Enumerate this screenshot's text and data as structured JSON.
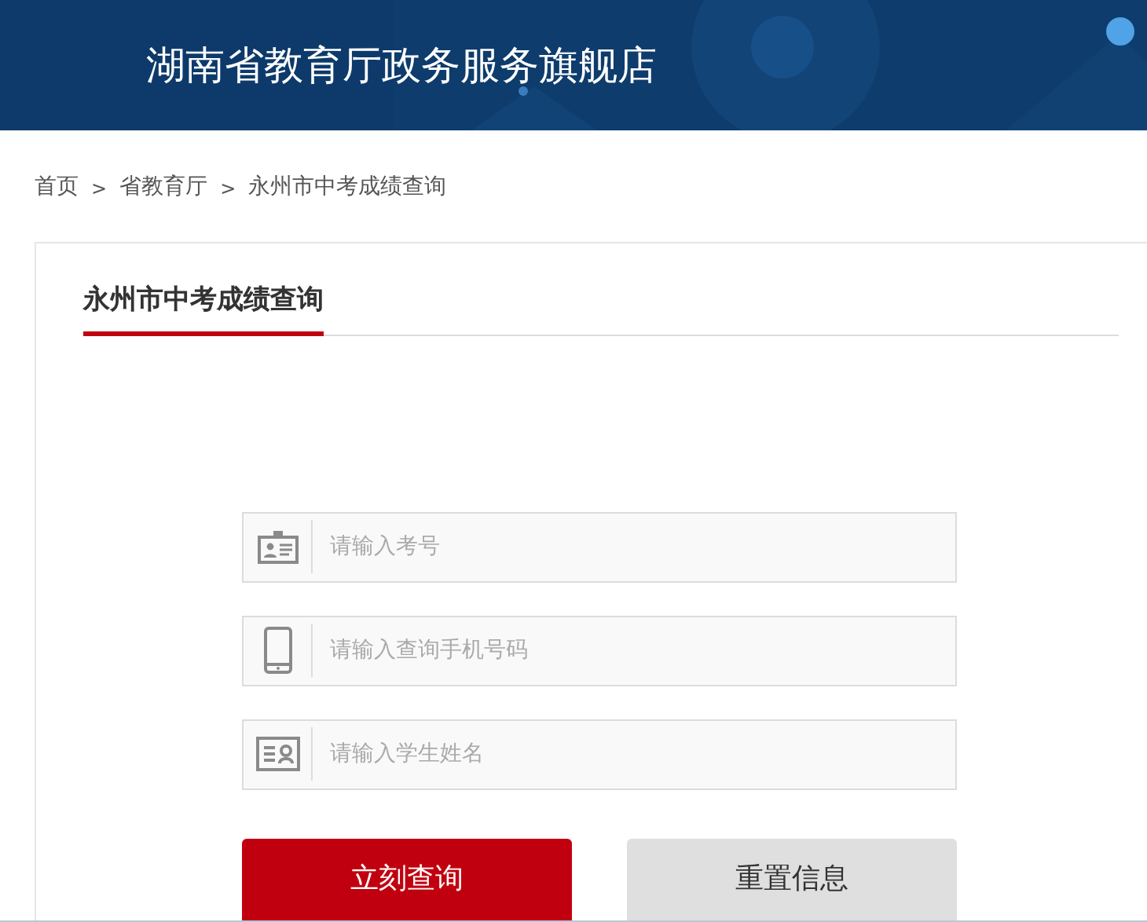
{
  "header": {
    "title": "湖南省教育厅政务服务旗舰店"
  },
  "breadcrumb": {
    "items": [
      "首页",
      "省教育厅",
      "永州市中考成绩查询"
    ],
    "separator": ">"
  },
  "panel": {
    "title": "永州市中考成绩查询"
  },
  "fields": [
    {
      "kind": "badge",
      "placeholder": "请输入考号"
    },
    {
      "kind": "phone",
      "placeholder": "请输入查询手机号码"
    },
    {
      "kind": "card",
      "placeholder": "请输入学生姓名"
    }
  ],
  "buttons": [
    {
      "kind": "primary",
      "label": "立刻查询"
    },
    {
      "kind": "secondary",
      "label": "重置信息"
    }
  ]
}
